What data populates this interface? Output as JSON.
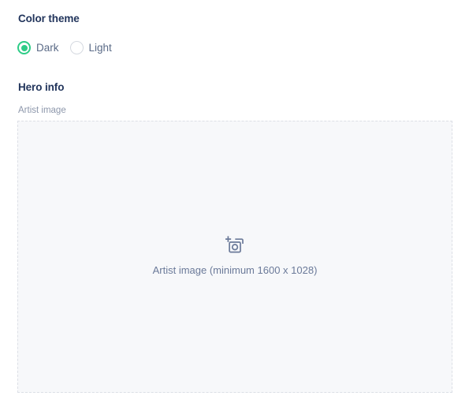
{
  "color_theme": {
    "heading": "Color theme",
    "selected": "Dark",
    "options": [
      {
        "label": "Dark",
        "selected": true,
        "icon": "radio-selected-icon"
      },
      {
        "label": "Light",
        "selected": false,
        "icon": "radio-unselected-icon"
      }
    ],
    "accent_color": "#2ecc87",
    "unselected_color": "#d5d9e0"
  },
  "hero_info": {
    "heading": "Hero info",
    "artist_image": {
      "label": "Artist image",
      "dropzone_icon": "add-photo-icon",
      "dropzone_caption": "Artist image (minimum 1600 x 1028)",
      "fill_color": "#f7f8fa",
      "border_color": "#dcdfe6"
    }
  }
}
